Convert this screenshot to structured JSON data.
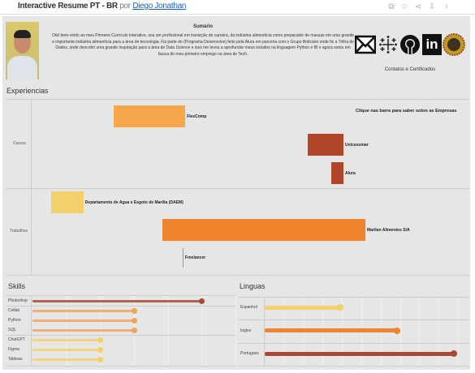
{
  "header": {
    "title": "Interactive Resume PT - BR",
    "by": "por",
    "author": "Diego Jonathan",
    "toolbar_icons": [
      "copy-icon",
      "star-icon",
      "share-icon",
      "download-icon",
      "badge-icon"
    ]
  },
  "summary": {
    "title": "Sumário",
    "text": "Olá! bem-vindo ao meu Primeiro Currículo Interativo, sou um profissional em transição de carreira, da indústria alimentícia como preparador de massas em uma grande e importante indústria alimentícia para a área de tecnologia. Fiz parte do  (Programa Desenvolve) feito pela Alura em parceria com o Grupo Boticário onde fiz a Trilha de Dados, onde descobri uma grande inspiração para a área de Data Science e isso me levou a aprofundar meus estudos na linguagem Python e BI e agora estou em busca do meu primeiro emprego na área de Tech."
  },
  "contacts": {
    "label": "Contatos e Certificados",
    "icons": [
      "gmail-icon",
      "tableau-icon",
      "github-icon",
      "linkedin-icon",
      "certificate-seal-icon"
    ]
  },
  "experiences": {
    "title": "Experiencias",
    "hint": "Clique nas barra para saber sobre as Empresas",
    "timeline_range": [
      0,
      100
    ],
    "groups": [
      {
        "label": "Cursos",
        "items": [
          {
            "name": "FlexComp",
            "start": 18.9,
            "end": 35.2,
            "color": "#f5a84a"
          },
          {
            "name": "Unicesumar",
            "start": 63.1,
            "end": 71.3,
            "color": "#b0452a"
          },
          {
            "name": "Alura",
            "start": 68.5,
            "end": 71.3,
            "color": "#b0452a"
          }
        ]
      },
      {
        "label": "Trabalhos",
        "items": [
          {
            "name": "Departamento de Agua e Esgoto de Marília (DAEM)",
            "start": 4.6,
            "end": 12.0,
            "color": "#f3d06a"
          },
          {
            "name": "Marilan Alimentos S/A",
            "start": 30.0,
            "end": 76.3,
            "color": "#f0832d"
          },
          {
            "name": "Freelancer",
            "start": 34.6,
            "end": 34.8,
            "color": "#999999"
          }
        ]
      }
    ]
  },
  "skills": {
    "title": "Skills",
    "max": 6,
    "items": [
      {
        "name": "Photoshop",
        "level": 5,
        "color": "#a84a36",
        "group": 0
      },
      {
        "name": "Collab",
        "level": 3,
        "color": "#f0a45a",
        "group": 1
      },
      {
        "name": "Python",
        "level": 3,
        "color": "#f0a45a",
        "group": 1
      },
      {
        "name": "SQL",
        "level": 3,
        "color": "#f0a45a",
        "group": 1
      },
      {
        "name": "ChatGPT",
        "level": 2,
        "color": "#f3d06a",
        "group": 2
      },
      {
        "name": "Figma",
        "level": 2,
        "color": "#f3d06a",
        "group": 2
      },
      {
        "name": "Tableau",
        "level": 2,
        "color": "#f3d06a",
        "group": 2
      }
    ]
  },
  "languages": {
    "title": "Linguas",
    "max": 10,
    "items": [
      {
        "name": "Espanhol",
        "level": 4,
        "color": "#f3d06a"
      },
      {
        "name": "Ingles",
        "level": 7,
        "color": "#f0832d"
      },
      {
        "name": "Portugues",
        "level": 10,
        "color": "#a84a36"
      }
    ]
  }
}
